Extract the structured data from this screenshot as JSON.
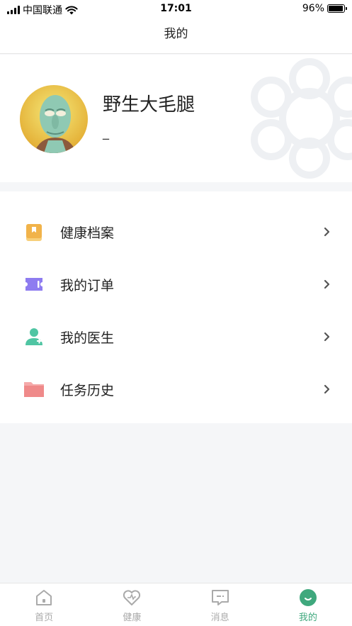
{
  "status": {
    "carrier": "中国联通",
    "time": "17:01",
    "battery": "96%",
    "battery_level": 0.96
  },
  "nav": {
    "title": "我的"
  },
  "profile": {
    "username": "野生大毛腿",
    "subtitle": "_"
  },
  "menu": {
    "items": [
      {
        "label": "健康档案",
        "icon": "health-record-icon",
        "color": "#f1b34a"
      },
      {
        "label": "我的订单",
        "icon": "order-ticket-icon",
        "color": "#8e7cf0"
      },
      {
        "label": "我的医生",
        "icon": "doctor-icon",
        "color": "#4fc5a3"
      },
      {
        "label": "任务历史",
        "icon": "folder-icon",
        "color": "#ef8a8a"
      }
    ]
  },
  "tabbar": {
    "tabs": [
      {
        "label": "首页",
        "icon": "home-icon",
        "active": false
      },
      {
        "label": "健康",
        "icon": "heart-icon",
        "active": false
      },
      {
        "label": "消息",
        "icon": "message-icon",
        "active": false
      },
      {
        "label": "我的",
        "icon": "profile-icon",
        "active": true
      }
    ]
  },
  "colors": {
    "accent": "#3fa87d",
    "inactive": "#aaaaaa",
    "background": "#f5f6f8"
  }
}
